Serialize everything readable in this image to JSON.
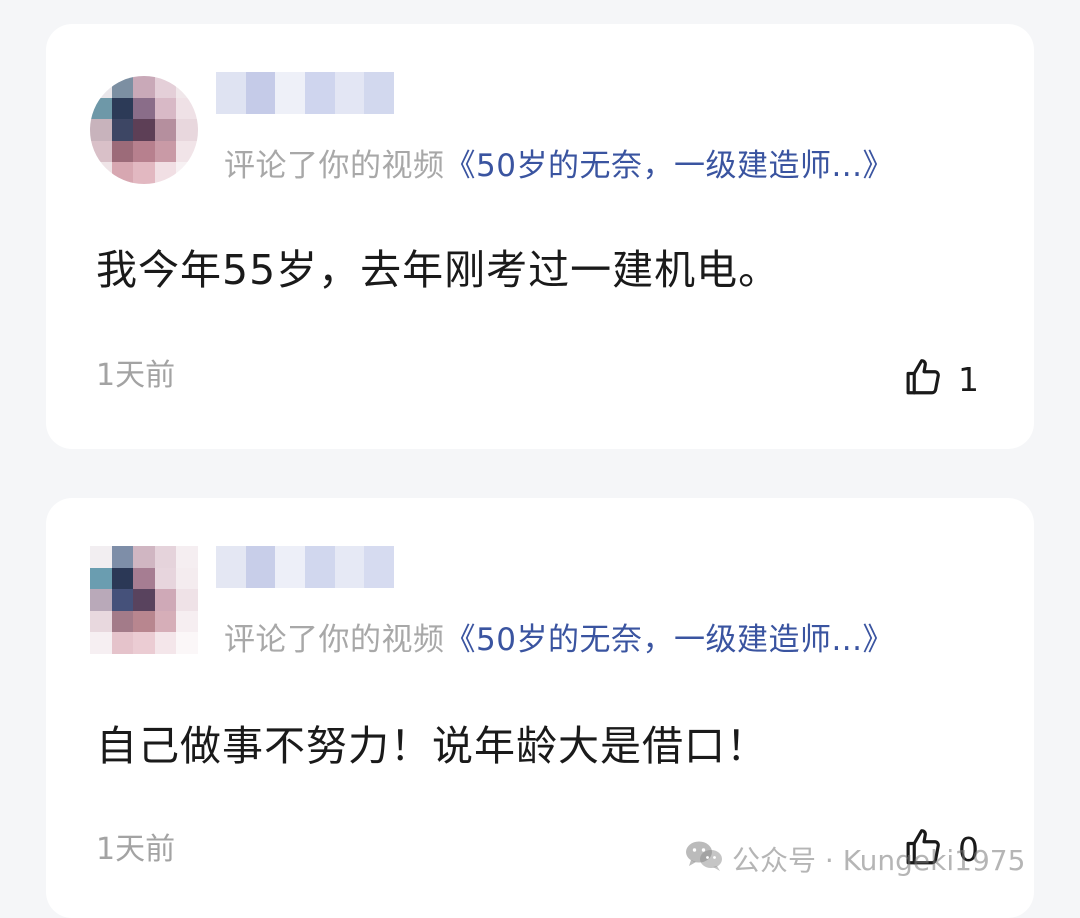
{
  "comments": [
    {
      "action_text": "评论了你的视频",
      "video_title": "《50岁的无奈，一级建造师...》",
      "content": "我今年55岁，去年刚考过一建机电。",
      "time": "1天前",
      "likes": "1",
      "like_icon": "thumbs-up-icon"
    },
    {
      "action_text": "评论了你的视频",
      "video_title": "《50岁的无奈，一级建造师...》",
      "content": "自己做事不努力！说年龄大是借口！",
      "time": "1天前",
      "likes": "0",
      "like_icon": "thumbs-up-icon"
    }
  ],
  "watermark": {
    "label": "公众号 · Kungeki1975",
    "icon": "wechat-icon"
  },
  "colors": {
    "background": "#f5f6f8",
    "card": "#ffffff",
    "link": "#3a54a0",
    "muted": "#a8a8a8",
    "text": "#1a1a1a"
  }
}
